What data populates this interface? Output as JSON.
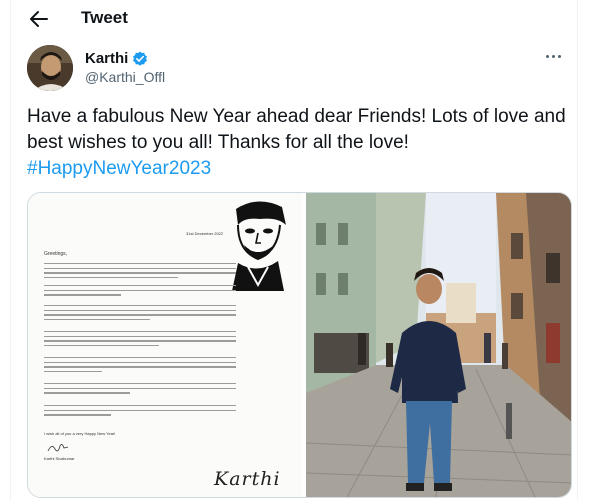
{
  "header": {
    "title": "Tweet",
    "back_icon": "arrow-left-icon"
  },
  "author": {
    "name": "Karthi",
    "handle": "@Karthi_Offl",
    "verified": true,
    "verified_icon": "verified-badge-icon",
    "more_icon": "more-horizontal-icon"
  },
  "tweet": {
    "text": "Have a fabulous New Year ahead dear Friends! Lots of love and best wishes to you all! Thanks for all the love!",
    "hashtag": "#HappyNewYear2023"
  },
  "media": {
    "letter": {
      "date": "31st December 2022",
      "greeting": "Greetings,",
      "closing": "I wish all of you a very Happy New Year!",
      "signed_name": "Karthi Sivakumar",
      "signature": "Karthi"
    }
  },
  "colors": {
    "accent": "#1d9bf0",
    "text": "#0f1419",
    "secondary": "#536471",
    "border": "#cfd9de"
  }
}
